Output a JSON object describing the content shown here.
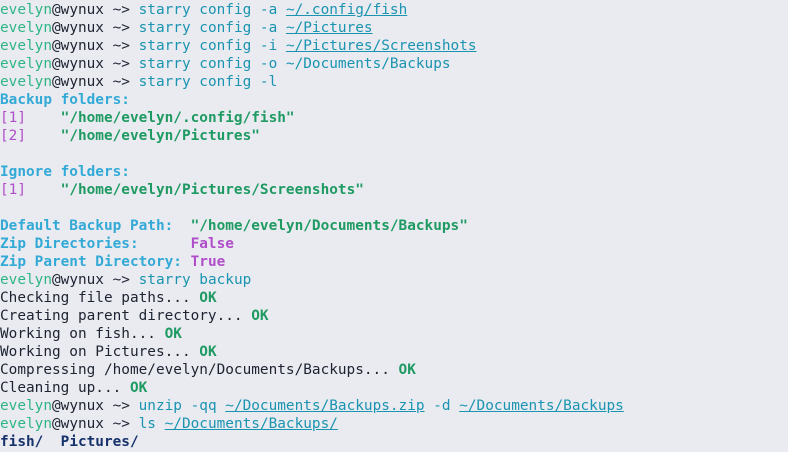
{
  "prompt": {
    "user": "evelyn",
    "at": "@",
    "host": "wynux",
    "arrow": " ~> "
  },
  "lines": [
    {
      "cmd": "starry config -a ",
      "path": "~/.config/fish"
    },
    {
      "cmd": "starry config -a ",
      "path": "~/Pictures"
    },
    {
      "cmd": "starry config -i ",
      "path": "~/Pictures/Screenshots"
    },
    {
      "cmd": "starry config -o ~/Documents/Backups"
    },
    {
      "cmd": "starry config -l"
    }
  ],
  "backup_header": "Backup folders:",
  "backup_items": [
    {
      "idx": "[1]",
      "path": "\"/home/evelyn/.config/fish\""
    },
    {
      "idx": "[2]",
      "path": "\"/home/evelyn/Pictures\""
    }
  ],
  "ignore_header": "Ignore folders:",
  "ignore_items": [
    {
      "idx": "[1]",
      "path": "\"/home/evelyn/Pictures/Screenshots\""
    }
  ],
  "settings": {
    "default_label": "Default Backup Path:",
    "default_value": "\"/home/evelyn/Documents/Backups\"",
    "zipdirs_label": "Zip Directories:",
    "zipdirs_value": "False",
    "zipparent_label": "Zip Parent Directory:",
    "zipparent_value": "True"
  },
  "backup_cmd": "starry backup",
  "progress": [
    {
      "text": "Checking file paths... ",
      "status": "OK"
    },
    {
      "text": "Creating parent directory... ",
      "status": "OK"
    },
    {
      "text": "Working on fish... ",
      "status": "OK"
    },
    {
      "text": "Working on Pictures... ",
      "status": "OK"
    },
    {
      "text": "Compressing /home/evelyn/Documents/Backups... ",
      "status": "OK"
    },
    {
      "text": "Cleaning up... ",
      "status": "OK"
    }
  ],
  "unzip": {
    "cmd": "unzip -qq ",
    "src": "~/Documents/Backups.zip",
    "flag": " -d ",
    "dst": "~/Documents/Backups"
  },
  "ls": {
    "cmd": "ls ",
    "path": "~/Documents/Backups/"
  },
  "ls_output": {
    "a": "fish/",
    "sep": "  ",
    "b": "Pictures/"
  }
}
